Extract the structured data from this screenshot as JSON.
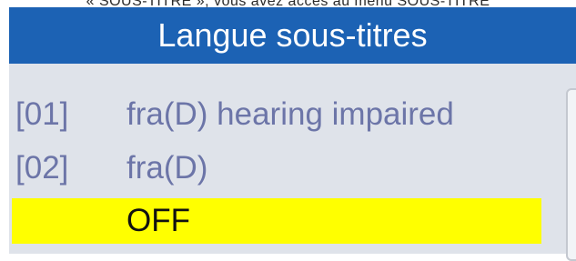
{
  "top_caption": "« SOUS-TITRE », vous avez accès au menu SOUS-TITRE",
  "menu": {
    "title": "Langue sous-titres",
    "items": [
      {
        "number": "[01]",
        "label": "fra(D) hearing impaired",
        "selected": false
      },
      {
        "number": "[02]",
        "label": "fra(D)",
        "selected": false
      },
      {
        "number": "",
        "label": "OFF",
        "selected": true
      }
    ]
  },
  "colors": {
    "title_bar": "#1c62b4",
    "panel": "#dfe3ea",
    "item_text": "#6c75a8",
    "highlight": "#ffff00"
  }
}
